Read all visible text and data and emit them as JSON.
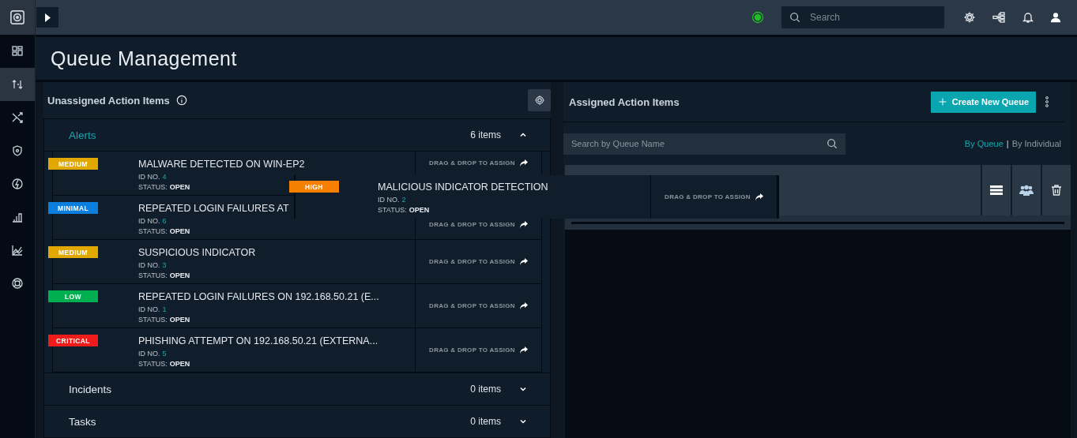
{
  "sidebar": {
    "items": [
      {
        "selected": false
      },
      {
        "selected": true
      },
      {
        "selected": false
      },
      {
        "selected": false
      },
      {
        "selected": false
      },
      {
        "selected": false
      },
      {
        "selected": false
      },
      {
        "selected": false
      }
    ]
  },
  "topbar": {
    "search": {
      "placeholder": "Search"
    }
  },
  "page": {
    "title": "Queue Management"
  },
  "unassigned": {
    "title": "Unassigned Action Items",
    "sections": [
      {
        "label": "Alerts",
        "count": "6 items",
        "expanded": true,
        "items": [
          {
            "severity": "MEDIUM",
            "color": "#e0a800",
            "title": "MALWARE DETECTED ON WIN-EP2",
            "id_label": "ID NO.",
            "id": "4",
            "status_label": "STATUS:",
            "status": "OPEN",
            "action": "DRAG & DROP TO ASSIGN"
          },
          {
            "severity": "MINIMAL",
            "color": "#0b7fe0",
            "title": "REPEATED LOGIN FAILURES AT",
            "id_label": "ID NO.",
            "id": "6",
            "status_label": "STATUS:",
            "status": "OPEN",
            "action": "DRAG & DROP TO ASSIGN"
          },
          {
            "severity": "MEDIUM",
            "color": "#e0a800",
            "title": "SUSPICIOUS INDICATOR",
            "id_label": "ID NO.",
            "id": "3",
            "status_label": "STATUS:",
            "status": "OPEN",
            "action": "DRAG & DROP TO ASSIGN"
          },
          {
            "severity": "LOW",
            "color": "#00b050",
            "title": "REPEATED LOGIN FAILURES ON 192.168.50.21 (E...",
            "id_label": "ID NO.",
            "id": "1",
            "status_label": "STATUS:",
            "status": "OPEN",
            "action": "DRAG & DROP TO ASSIGN"
          },
          {
            "severity": "CRITICAL",
            "color": "#f01c1c",
            "title": "PHISHING ATTEMPT ON 192.168.50.21 (EXTERNA...",
            "id_label": "ID NO.",
            "id": "5",
            "status_label": "STATUS:",
            "status": "OPEN",
            "action": "DRAG & DROP TO ASSIGN"
          }
        ]
      },
      {
        "label": "Incidents",
        "count": "0 items",
        "expanded": false
      },
      {
        "label": "Tasks",
        "count": "0 items",
        "expanded": false
      }
    ]
  },
  "dragged_item": {
    "severity": "HIGH",
    "color": "#f57f00",
    "title": "MALICIOUS INDICATOR DETECTION",
    "id_label": "ID NO.",
    "id": "2",
    "status_label": "STATUS:",
    "status": "OPEN",
    "action": "DRAG & DROP TO ASSIGN"
  },
  "assigned": {
    "title": "Assigned Action Items",
    "create_button": "Create New Queue",
    "search": {
      "placeholder": "Search by Queue Name"
    },
    "views": [
      {
        "label": "By Queue",
        "selected": true
      },
      {
        "label": "By Individual",
        "selected": false
      }
    ],
    "separator": "|"
  }
}
